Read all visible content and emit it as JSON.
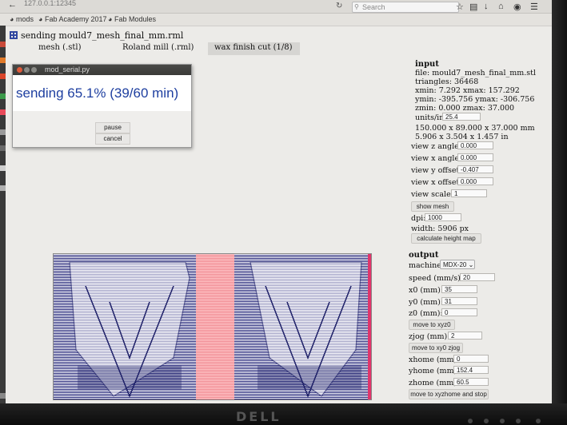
{
  "browser": {
    "url": "127.0.0.1:12345",
    "search_placeholder": "Search",
    "bookmarks": [
      "mods",
      "Fab Academy 2017",
      "Fab Modules"
    ]
  },
  "app": {
    "title": "sending mould7_mesh_final_mm.rml",
    "modules": [
      "mesh (.stl)",
      "Roland mill (.rml)",
      "wax finish cut (1/8)"
    ]
  },
  "dialog": {
    "title": "mod_serial.py",
    "progress_text": "sending 65.1% (39/60 min)",
    "progress_percent": 65.1,
    "pause_label": "pause",
    "cancel_label": "cancel"
  },
  "input": {
    "heading": "input",
    "file": "file: mould7_mesh_final_mm.stl",
    "triangles": "triangles: 36468",
    "xrange": "xmin: 7.292 xmax: 157.292",
    "yrange": "ymin: -395.756 ymax: -306.756",
    "zrange": "zmin: 0.000 zmax: 37.000",
    "units_label": "units/in:",
    "units_value": "25.4",
    "size_mm": "150.000 x 89.000 x 37.000 mm",
    "size_in": "5.906 x 3.504 x 1.457 in",
    "view_z_label": "view z angle:",
    "view_z_value": "0.000",
    "view_x_label": "view x angle:",
    "view_x_value": "0.000",
    "view_y_offset_label": "view y offset:",
    "view_y_offset_value": "-0.407",
    "view_x_offset_label": "view x offset:",
    "view_x_offset_value": "0.000",
    "view_scale_label": "view scale:",
    "view_scale_value": "1",
    "show_mesh_label": "show mesh",
    "dpi_label": "dpi:",
    "dpi_value": "1000",
    "width_text": "width: 5906 px",
    "calc_label": "calculate height map"
  },
  "output": {
    "heading": "output",
    "machine_label": "machine",
    "machine_value": "MDX-20",
    "speed_label": "speed (mm/s):",
    "speed_value": "20",
    "x0_label": "x0 (mm):",
    "x0_value": "35",
    "y0_label": "y0 (mm):",
    "y0_value": "31",
    "z0_label": "z0 (mm):",
    "z0_value": "0",
    "move_xyz0_label": "move to xyz0",
    "zjog_label": "zjog (mm):",
    "zjog_value": "2",
    "move_xy0_label": "move to xy0 zjog",
    "xhome_label": "xhome (mm):",
    "xhome_value": "0",
    "yhome_label": "yhome (mm):",
    "yhome_value": "152.4",
    "zhome_label": "zhome (mm):",
    "zhome_value": "60.5",
    "move_home_label": "move to xyzhome and stop"
  },
  "brand": "DELL",
  "colors": {
    "progress_text": "#1e3fa0",
    "toolpath": "#25277a",
    "pink_band": "#f08a92"
  }
}
